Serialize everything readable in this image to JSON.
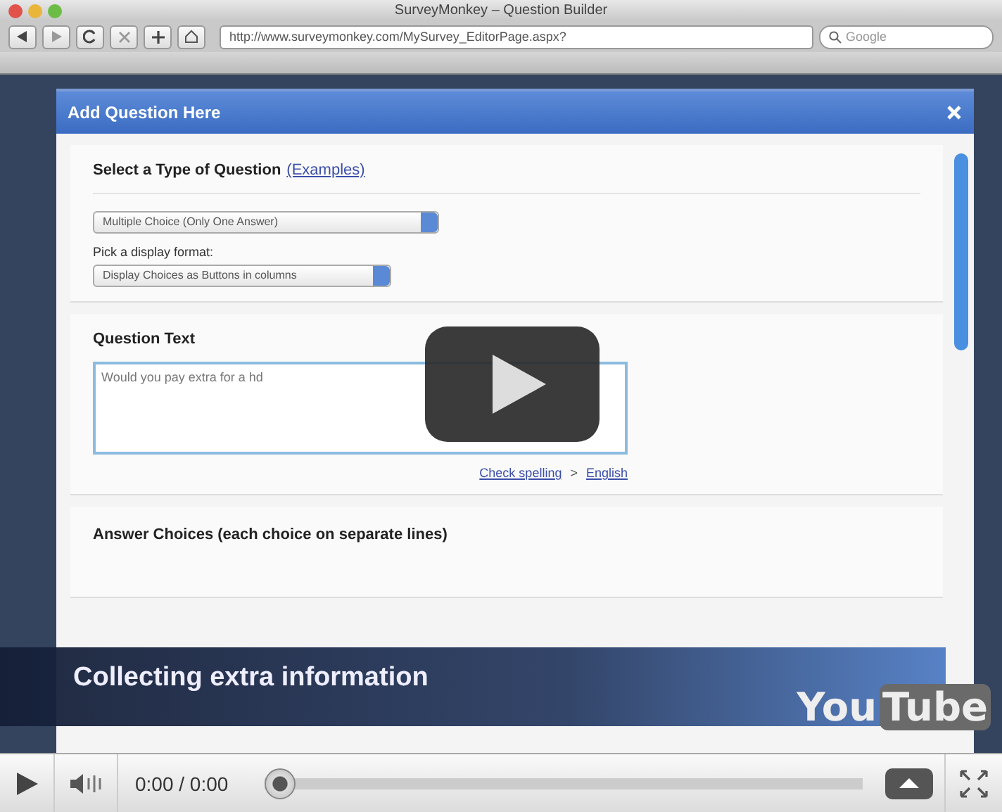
{
  "browser": {
    "title": "SurveyMonkey – Question Builder",
    "url": "http://www.surveymonkey.com/MySurvey_EditorPage.aspx?",
    "search_placeholder": "Google"
  },
  "dialog": {
    "title": "Add Question Here",
    "type_heading": "Select a Type of Question",
    "examples_link": "(Examples)",
    "question_type": "Multiple Choice (Only One Answer)",
    "format_label": "Pick a display format:",
    "display_format": "Display Choices as Buttons in columns",
    "question_heading": "Question Text",
    "question_text": "Would you pay extra for a hd",
    "spell_link": "Check spelling",
    "spell_separator": ">",
    "language_link": "English",
    "answers_heading": "Answer Choices (each choice on separate lines)"
  },
  "caption": "Collecting extra information",
  "logo": {
    "you": "You",
    "tube": "Tube"
  },
  "player": {
    "playing": false,
    "time": "0:00 / 0:00",
    "level": 0
  }
}
